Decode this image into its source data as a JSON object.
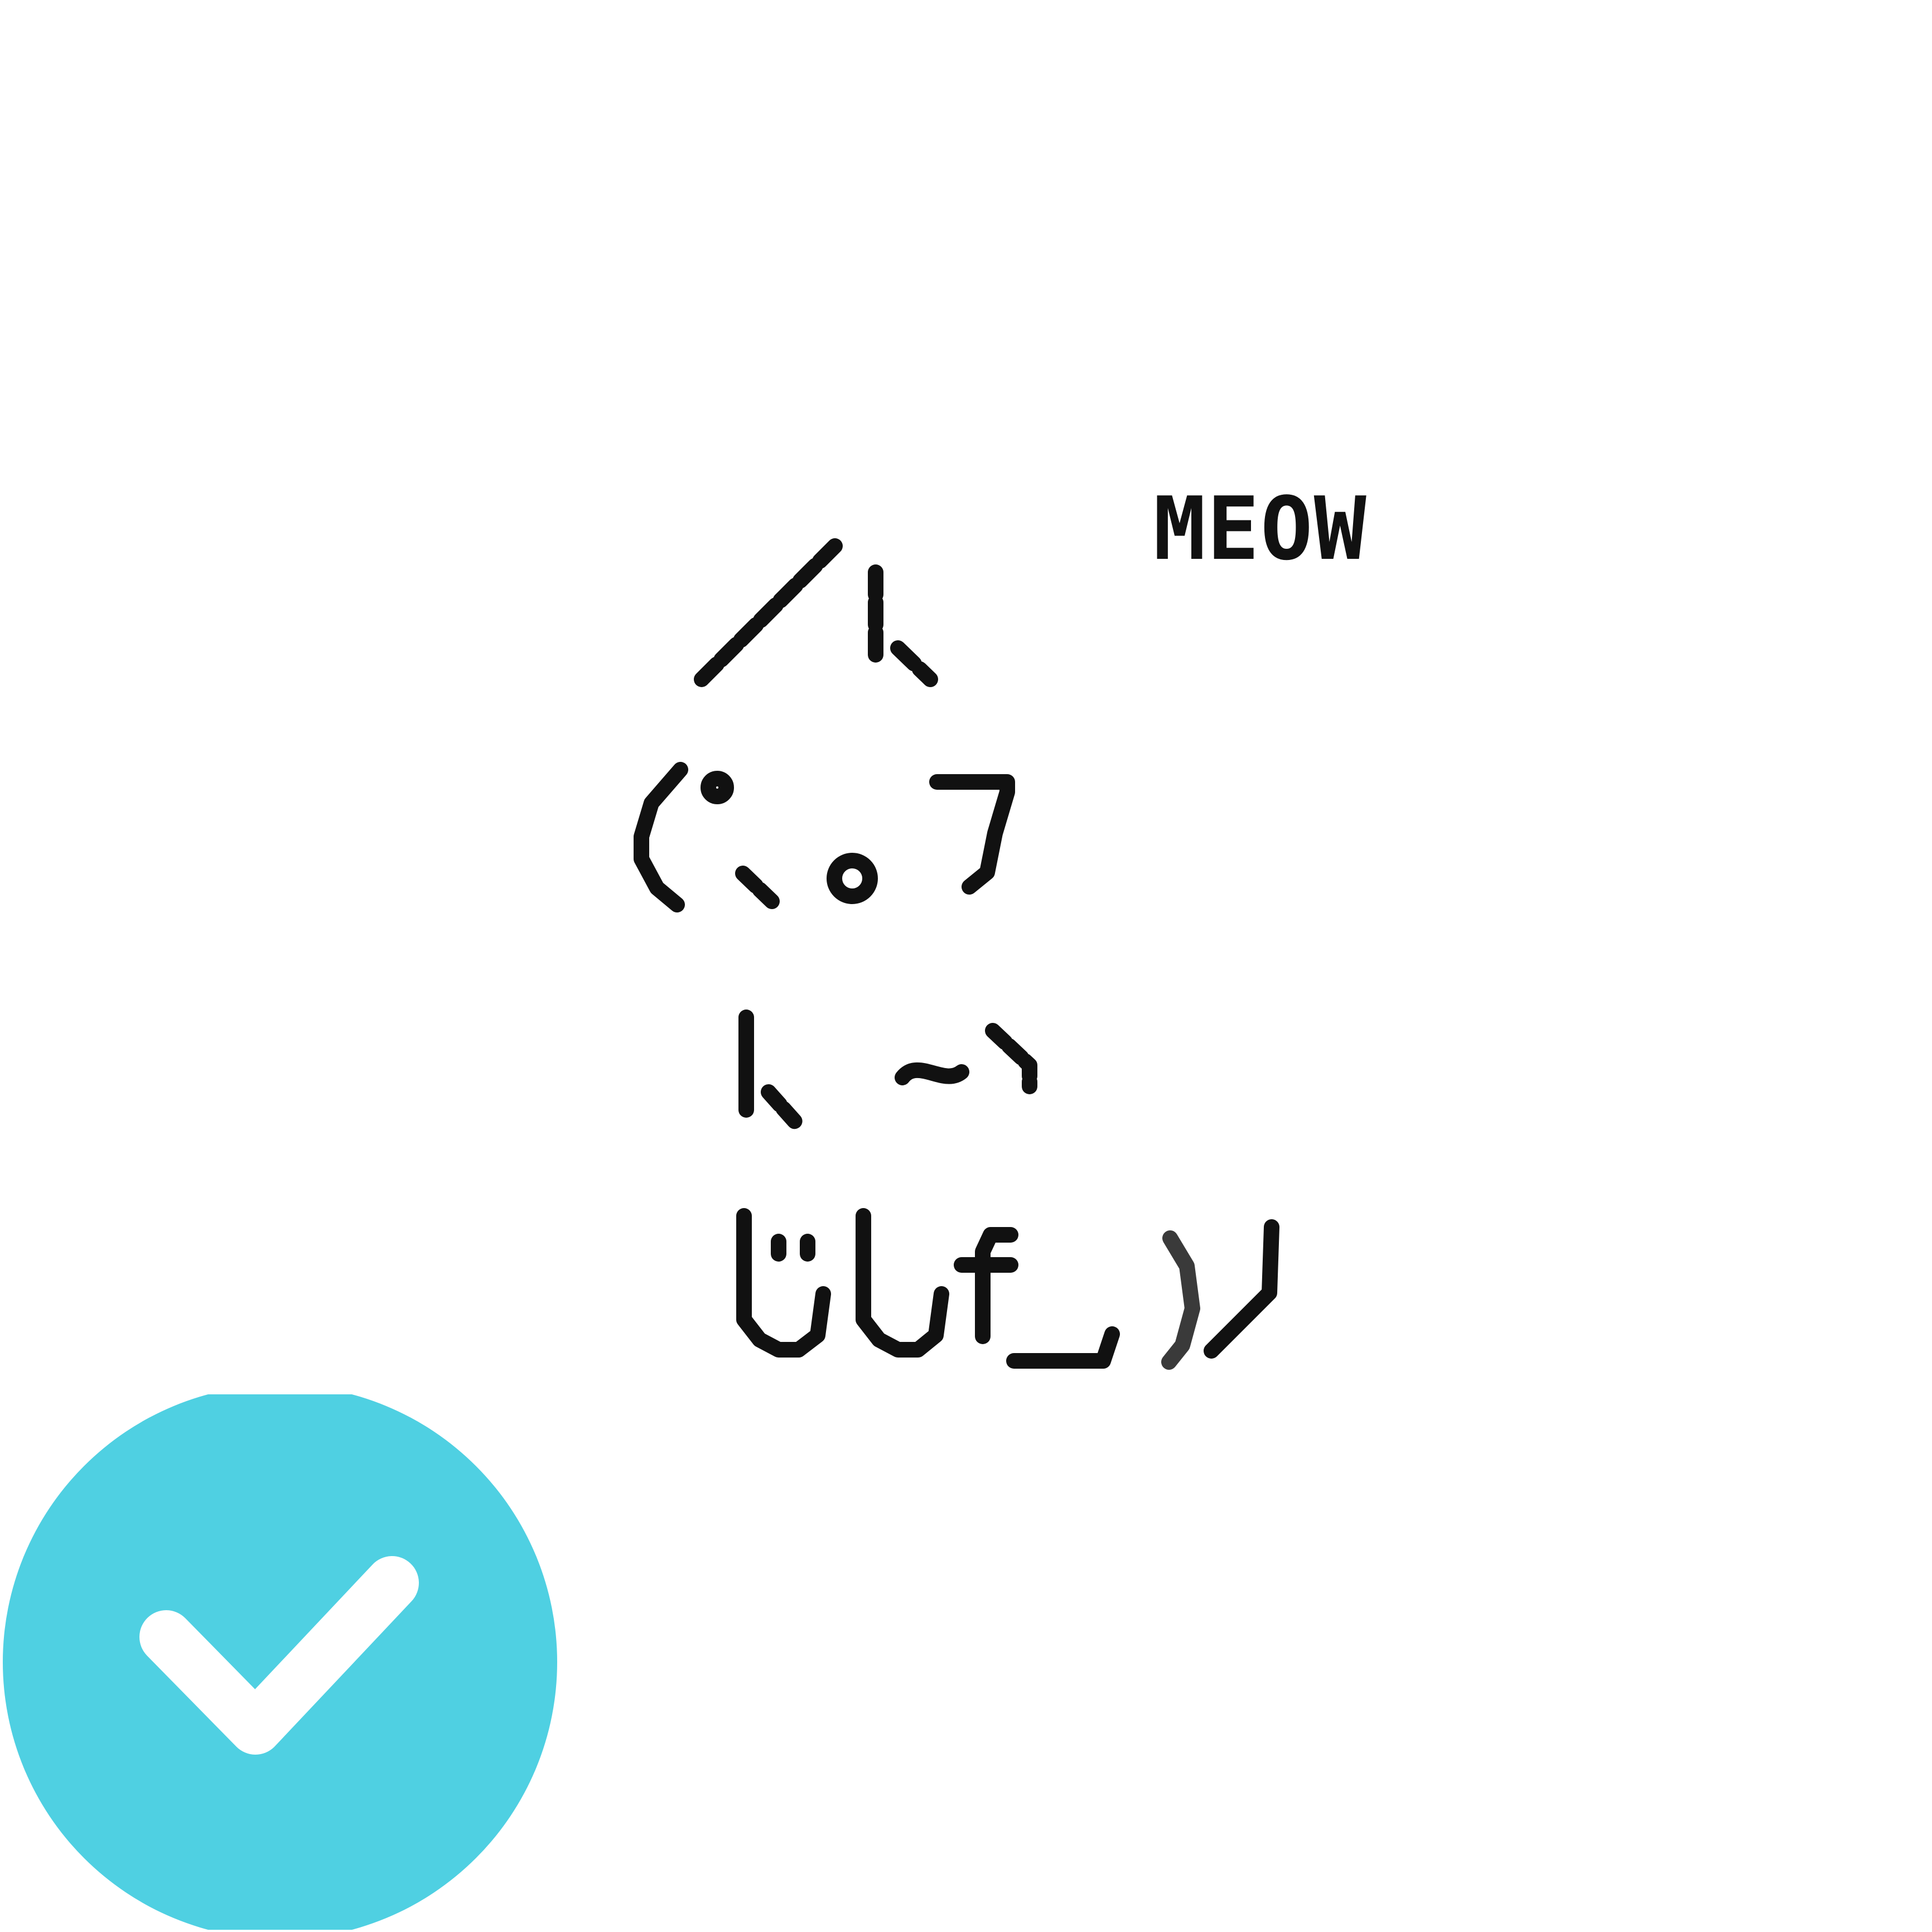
{
  "caption": "MEOW",
  "colors": {
    "ink": "#111111",
    "badge": "#4FD0E2",
    "check": "#ffffff"
  },
  "icons": {
    "badge": "check-circle-icon"
  }
}
